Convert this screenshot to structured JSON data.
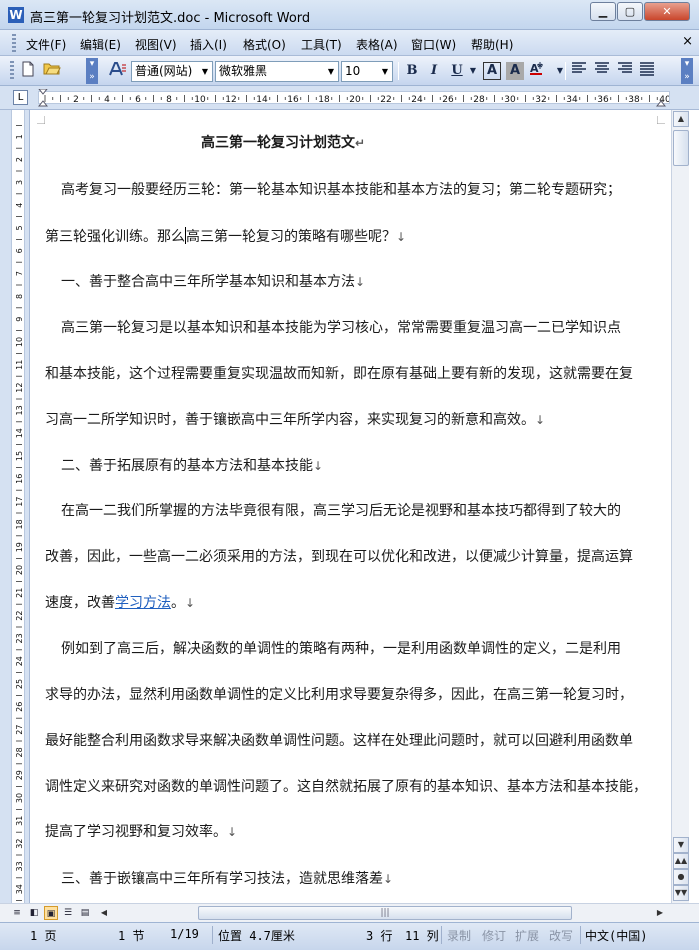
{
  "window": {
    "title": "高三第一轮复习计划范文.doc - Microsoft Word",
    "app_icon": "W",
    "minimize": "▁",
    "maximize": "▢",
    "close": "✕"
  },
  "menubar": {
    "items": [
      "文件(F)",
      "编辑(E)",
      "视图(V)",
      "插入(I)",
      "格式(O)",
      "工具(T)",
      "表格(A)",
      "窗口(W)",
      "帮助(H)"
    ],
    "close_doc": "×"
  },
  "toolbar": {
    "style_value": "普通(网站)",
    "font_value": "微软雅黑",
    "size_value": "10",
    "bold": "B",
    "italic": "I",
    "underline": "U",
    "char_border": "A",
    "char_shading": "A",
    "fontcolor": "A"
  },
  "ruler": {
    "tab_selector": "L",
    "h_labels": [
      "2",
      "4",
      "6",
      "8",
      "10",
      "12",
      "14",
      "16",
      "18",
      "20",
      "22",
      "24",
      "26",
      "28",
      "30",
      "32",
      "34",
      "36",
      "38",
      "40"
    ],
    "v_labels": [
      "1",
      "2",
      "3",
      "4",
      "5",
      "6",
      "7",
      "8",
      "9",
      "10",
      "11",
      "12",
      "13",
      "14",
      "15",
      "16",
      "17",
      "18",
      "19",
      "20",
      "21",
      "22",
      "23",
      "24",
      "25",
      "26",
      "27",
      "28",
      "29",
      "30",
      "31",
      "32",
      "33",
      "34"
    ]
  },
  "document": {
    "title": "高三第一轮复习计划范文",
    "p1_line1": "高考复习一般要经历三轮：第一轮基本知识基本技能和基本方法的复习；第二轮专题研究；",
    "p1_line2a": "第三轮强化训练。那么",
    "p1_line2b": "高三第一轮复习的策略有哪些呢？",
    "h1": "一、善于整合高中三年所学基本知识和基本方法",
    "p2_line1": "高三第一轮复习是以基本知识和基本技能为学习核心，常常需要重复温习高一二已学知识点",
    "p2_line2": "和基本技能，这个过程需要重复实现温故而知新，即在原有基础上要有新的发现，这就需要在复",
    "p2_line3": "习高一二所学知识时，善于镶嵌高中三年所学内容，来实现复习的新意和高效。",
    "h2": "二、善于拓展原有的基本方法和基本技能",
    "p3_line1": "在高一二我们所掌握的方法毕竟很有限，高三学习后无论是视野和基本技巧都得到了较大的",
    "p3_line2": "改善，因此，一些高一二必须采用的方法，到现在可以优化和改进，以便减少计算量，提高运算",
    "p3_line3a": "速度，改善",
    "p3_link": "学习方法",
    "p3_line3b": "。",
    "p4_line1": "例如到了高三后，解决函数的单调性的策略有两种，一是利用函数单调性的定义，二是利用",
    "p4_line2": "求导的办法，显然利用函数单调性的定义比利用求导要复杂得多，因此，在高三第一轮复习时，",
    "p4_line3": "最好能整合利用函数求导来解决函数单调性问题。这样在处理此问题时，就可以回避利用函数单",
    "p4_line4": "调性定义来研究对函数的单调性问题了。这自然就拓展了原有的基本知识、基本方法和基本技能，",
    "p4_line5": "提高了学习视野和复习效率。",
    "h3": "三、善于嵌镶高中三年所有学习技法，造就思维落差",
    "para_mark": "↵",
    "line_mark": "↓"
  },
  "statusbar": {
    "page": "1 页",
    "section": "1 节",
    "pages": "1/19",
    "position": "位置 4.7厘米",
    "line": "3 行",
    "column": "11 列",
    "rec": "录制",
    "trk": "修订",
    "ext": "扩展",
    "ovr": "改写",
    "language": "中文(中国)"
  }
}
